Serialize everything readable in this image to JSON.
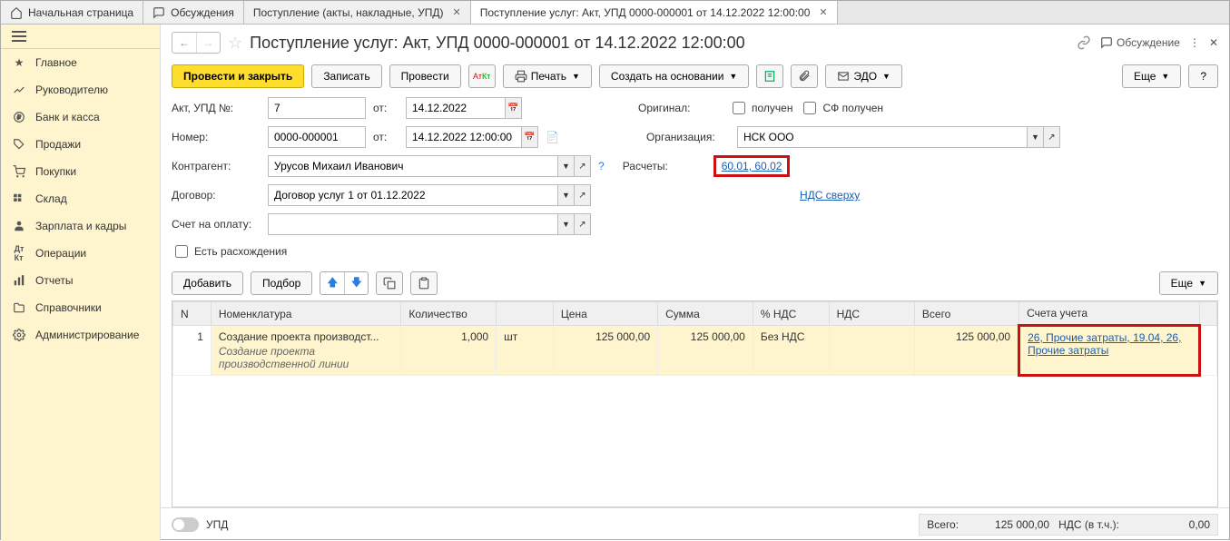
{
  "tabs": [
    {
      "label": "Начальная страница",
      "icon": "home"
    },
    {
      "label": "Обсуждения",
      "icon": "chat"
    },
    {
      "label": "Поступление (акты, накладные, УПД)",
      "closable": true
    },
    {
      "label": "Поступление услуг: Акт, УПД 0000-000001 от 14.12.2022 12:00:00",
      "closable": true,
      "active": true
    }
  ],
  "sidebar": {
    "items": [
      {
        "label": "Главное",
        "icon": "star"
      },
      {
        "label": "Руководителю",
        "icon": "trend"
      },
      {
        "label": "Банк и касса",
        "icon": "coin"
      },
      {
        "label": "Продажи",
        "icon": "tag"
      },
      {
        "label": "Покупки",
        "icon": "cart"
      },
      {
        "label": "Склад",
        "icon": "boxes"
      },
      {
        "label": "Зарплата и кадры",
        "icon": "person"
      },
      {
        "label": "Операции",
        "icon": "dkt"
      },
      {
        "label": "Отчеты",
        "icon": "bars"
      },
      {
        "label": "Справочники",
        "icon": "folder"
      },
      {
        "label": "Администрирование",
        "icon": "gear"
      }
    ]
  },
  "title": "Поступление услуг: Акт, УПД 0000-000001 от 14.12.2022 12:00:00",
  "title_right": {
    "discuss": "Обсуждение"
  },
  "toolbar": {
    "post_close": "Провести и закрыть",
    "write": "Записать",
    "post": "Провести",
    "print": "Печать",
    "create_based": "Создать на основании",
    "edo": "ЭДО",
    "more": "Еще",
    "help": "?"
  },
  "form": {
    "act_label": "Акт, УПД №:",
    "act_value": "7",
    "from_label": "от:",
    "act_date": "14.12.2022",
    "num_label": "Номер:",
    "num_value": "0000-000001",
    "num_datetime": "14.12.2022 12:00:00",
    "original_label": "Оригинал:",
    "poluchen": "получен",
    "sf_poluchen": "СФ получен",
    "org_label": "Организация:",
    "org_value": "НСК ООО",
    "contractor_label": "Контрагент:",
    "contractor_value": "Урусов Михаил Иванович",
    "calc_label": "Расчеты:",
    "calc_link": "60.01, 60.02",
    "contract_label": "Договор:",
    "contract_value": "Договор услуг 1 от 01.12.2022",
    "vat_link": "НДС сверху",
    "invoice_label": "Счет на оплату:",
    "discrepancy": "Есть расхождения"
  },
  "subbar": {
    "add": "Добавить",
    "pick": "Подбор",
    "more": "Еще"
  },
  "table": {
    "headers": {
      "n": "N",
      "nomen": "Номенклатура",
      "qty": "Количество",
      "unit": "",
      "price": "Цена",
      "sum": "Сумма",
      "vat_pct": "% НДС",
      "vat": "НДС",
      "total": "Всего",
      "accounts": "Счета учета"
    },
    "rows": [
      {
        "n": "1",
        "nomen": "Создание проекта производст...",
        "nomen_full": "Создание проекта производственной линии",
        "qty": "1,000",
        "unit": "шт",
        "price": "125 000,00",
        "sum": "125 000,00",
        "vat_pct": "Без НДС",
        "vat": "",
        "total": "125 000,00",
        "accounts": "26, Прочие затраты, 19.04, 26, Прочие затраты"
      }
    ]
  },
  "footer": {
    "upd": "УПД",
    "total_label": "Всего:",
    "total_value": "125 000,00",
    "vat_label": "НДС (в т.ч.):",
    "vat_value": "0,00"
  }
}
